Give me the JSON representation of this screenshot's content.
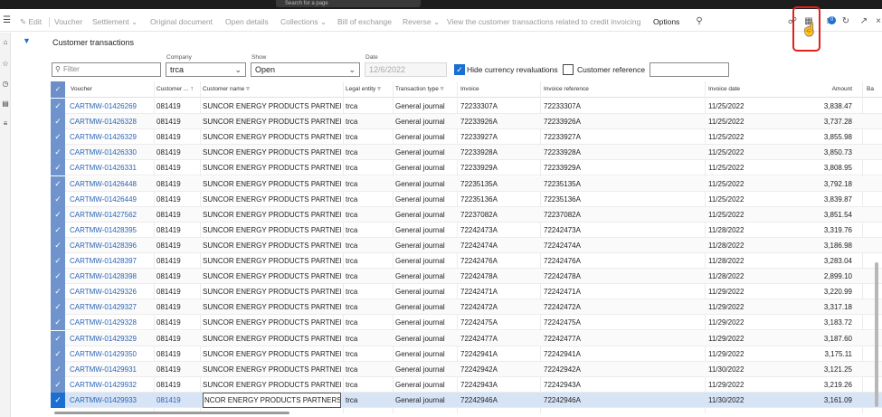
{
  "topbar": {
    "search_text": "Search for a page"
  },
  "toolbar": {
    "menu_icon": "hamburger-icon",
    "items": [
      {
        "label": "Edit",
        "icon": "pencil-icon"
      },
      {
        "label": "Voucher"
      },
      {
        "label": "Settlement",
        "has_dropdown": true
      },
      {
        "label": "Original document"
      },
      {
        "label": "Open details"
      },
      {
        "label": "Collections",
        "has_dropdown": true
      },
      {
        "label": "Bill of exchange"
      },
      {
        "label": "Reverse",
        "has_dropdown": true
      },
      {
        "label": "View the customer transactions related to credit invoicing"
      },
      {
        "label": "Options"
      }
    ],
    "notification_count": "0",
    "right_icons": [
      "attach-icon",
      "office-icon",
      "message-icon",
      "refresh-icon",
      "popout-icon",
      "close-icon"
    ]
  },
  "leftnav": {
    "icons": [
      "home-icon",
      "star-icon",
      "recent-icon",
      "workspace-icon",
      "list-icon"
    ]
  },
  "page": {
    "title": "Customer transactions"
  },
  "filters": {
    "filter_placeholder": "Filter",
    "company_label": "Company",
    "company_value": "trca",
    "show_label": "Show",
    "show_value": "Open",
    "date_label": "Date",
    "date_value": "12/6/2022",
    "hide_currency_label": "Hide currency revaluations",
    "hide_currency_checked": true,
    "customer_ref_label": "Customer reference",
    "customer_ref_checked": false,
    "customer_ref_value": ""
  },
  "grid": {
    "columns": [
      "Voucher",
      "Customer ...",
      "Customer name",
      "Legal entity",
      "Transaction type",
      "Invoice",
      "Invoice reference",
      "Invoice date",
      "Amount",
      "Ba"
    ],
    "rows": [
      [
        "CARTMW-01426269",
        "081419",
        "SUNCOR ENERGY PRODUCTS PARTNER...",
        "trca",
        "General journal",
        "72233307A",
        "72233307A",
        "11/25/2022",
        "3,838.47"
      ],
      [
        "CARTMW-01426328",
        "081419",
        "SUNCOR ENERGY PRODUCTS PARTNER...",
        "trca",
        "General journal",
        "72233926A",
        "72233926A",
        "11/25/2022",
        "3,737.28"
      ],
      [
        "CARTMW-01426329",
        "081419",
        "SUNCOR ENERGY PRODUCTS PARTNER...",
        "trca",
        "General journal",
        "72233927A",
        "72233927A",
        "11/25/2022",
        "3,855.98"
      ],
      [
        "CARTMW-01426330",
        "081419",
        "SUNCOR ENERGY PRODUCTS PARTNER...",
        "trca",
        "General journal",
        "72233928A",
        "72233928A",
        "11/25/2022",
        "3,850.73"
      ],
      [
        "CARTMW-01426331",
        "081419",
        "SUNCOR ENERGY PRODUCTS PARTNER...",
        "trca",
        "General journal",
        "72233929A",
        "72233929A",
        "11/25/2022",
        "3,808.95"
      ],
      [
        "CARTMW-01426448",
        "081419",
        "SUNCOR ENERGY PRODUCTS PARTNER...",
        "trca",
        "General journal",
        "72235135A",
        "72235135A",
        "11/25/2022",
        "3,792.18"
      ],
      [
        "CARTMW-01426449",
        "081419",
        "SUNCOR ENERGY PRODUCTS PARTNER...",
        "trca",
        "General journal",
        "72235136A",
        "72235136A",
        "11/25/2022",
        "3,839.87"
      ],
      [
        "CARTMW-01427562",
        "081419",
        "SUNCOR ENERGY PRODUCTS PARTNER...",
        "trca",
        "General journal",
        "72237082A",
        "72237082A",
        "11/25/2022",
        "3,851.54"
      ],
      [
        "CARTMW-01428395",
        "081419",
        "SUNCOR ENERGY PRODUCTS PARTNER...",
        "trca",
        "General journal",
        "72242473A",
        "72242473A",
        "11/28/2022",
        "3,319.76"
      ],
      [
        "CARTMW-01428396",
        "081419",
        "SUNCOR ENERGY PRODUCTS PARTNER...",
        "trca",
        "General journal",
        "72242474A",
        "72242474A",
        "11/28/2022",
        "3,186.98"
      ],
      [
        "CARTMW-01428397",
        "081419",
        "SUNCOR ENERGY PRODUCTS PARTNER...",
        "trca",
        "General journal",
        "72242476A",
        "72242476A",
        "11/28/2022",
        "3,283.04"
      ],
      [
        "CARTMW-01428398",
        "081419",
        "SUNCOR ENERGY PRODUCTS PARTNER...",
        "trca",
        "General journal",
        "72242478A",
        "72242478A",
        "11/28/2022",
        "2,899.10"
      ],
      [
        "CARTMW-01429326",
        "081419",
        "SUNCOR ENERGY PRODUCTS PARTNER...",
        "trca",
        "General journal",
        "72242471A",
        "72242471A",
        "11/29/2022",
        "3,220.99"
      ],
      [
        "CARTMW-01429327",
        "081419",
        "SUNCOR ENERGY PRODUCTS PARTNER...",
        "trca",
        "General journal",
        "72242472A",
        "72242472A",
        "11/29/2022",
        "3,317.18"
      ],
      [
        "CARTMW-01429328",
        "081419",
        "SUNCOR ENERGY PRODUCTS PARTNER...",
        "trca",
        "General journal",
        "72242475A",
        "72242475A",
        "11/29/2022",
        "3,183.72"
      ],
      [
        "CARTMW-01429329",
        "081419",
        "SUNCOR ENERGY PRODUCTS PARTNER...",
        "trca",
        "General journal",
        "72242477A",
        "72242477A",
        "11/29/2022",
        "3,187.60"
      ],
      [
        "CARTMW-01429350",
        "081419",
        "SUNCOR ENERGY PRODUCTS PARTNER...",
        "trca",
        "General journal",
        "72242941A",
        "72242941A",
        "11/29/2022",
        "3,175.11"
      ],
      [
        "CARTMW-01429931",
        "081419",
        "SUNCOR ENERGY PRODUCTS PARTNER...",
        "trca",
        "General journal",
        "72242942A",
        "72242942A",
        "11/30/2022",
        "3,121.25"
      ],
      [
        "CARTMW-01429932",
        "081419",
        "SUNCOR ENERGY PRODUCTS PARTNER...",
        "trca",
        "General journal",
        "72242943A",
        "72242943A",
        "11/29/2022",
        "3,219.26"
      ],
      [
        "CARTMW-01429933",
        "081419",
        "NCOR ENERGY PRODUCTS PARTNERSHIP",
        "trca",
        "General journal",
        "72242946A",
        "72242946A",
        "11/30/2022",
        "3,161.09"
      ]
    ],
    "selected_row": 19
  },
  "colors": {
    "accent": "#1a6fd1",
    "link": "#2a64b6",
    "annotation": "#e0201b",
    "selection": "#d7e4f6"
  }
}
